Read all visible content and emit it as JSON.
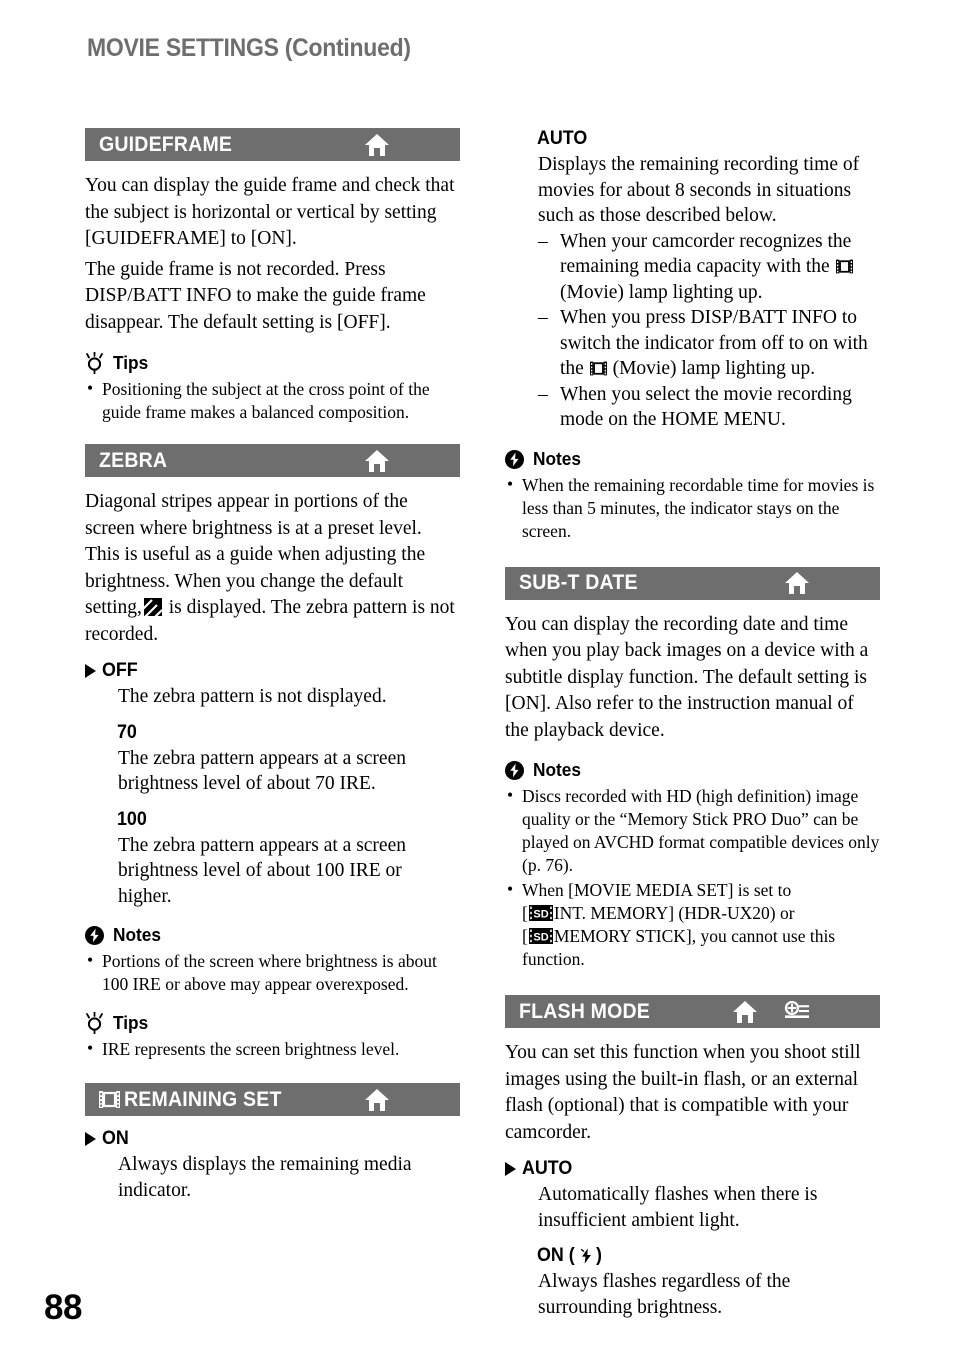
{
  "page": {
    "running_head": "MOVIE SETTINGS (Continued)",
    "page_number": "88",
    "bar_color": "#6e6e6e",
    "head_color": "#6e6e6e"
  },
  "labels": {
    "notes": "Notes",
    "tips": "Tips"
  },
  "left_column": {
    "guideframe": {
      "title": "GUIDEFRAME",
      "body": "You can display the guide frame and check that the subject is horizontal or vertical by setting [GUIDEFRAME] to [ON].",
      "body2": "The guide frame is not recorded. Press DISP/BATT INFO to make the guide frame disappear. The default setting is [OFF].",
      "tips": [
        "Positioning the subject at the cross point of the guide frame makes a balanced composition."
      ]
    },
    "zebra": {
      "title": "ZEBRA",
      "body_part1": "Diagonal stripes appear in portions of the screen where brightness is at a preset level. This is useful as a guide when adjusting the brightness. When you change the default setting,",
      "body_part2": "is displayed. The zebra pattern is not recorded.",
      "options": [
        {
          "name": "OFF",
          "default": true,
          "body": "The zebra pattern is not displayed."
        },
        {
          "name": "70",
          "default": false,
          "body": "The zebra pattern appears at a screen brightness level of about 70 IRE."
        },
        {
          "name": "100",
          "default": false,
          "body": "The zebra pattern appears at a screen brightness level of about 100 IRE or higher."
        }
      ],
      "notes": [
        "Portions of the screen where brightness is about 100 IRE or above may appear overexposed."
      ],
      "tips": [
        "IRE represents the screen brightness level."
      ]
    },
    "remaining_set": {
      "title": "REMAINING SET",
      "options": [
        {
          "name": "ON",
          "default": true,
          "body": "Always displays the remaining media indicator."
        }
      ]
    }
  },
  "right_column": {
    "remaining_set_cont": {
      "options": [
        {
          "name": "AUTO",
          "default": false,
          "body": "Displays the remaining recording time of movies for about 8 seconds in situations such as those described below."
        }
      ],
      "dash_items": [
        {
          "part1": "When your camcorder recognizes the remaining media capacity with the",
          "part2": "(Movie) lamp lighting up."
        },
        {
          "part1": "When you press DISP/BATT INFO to switch the indicator from off to on with the",
          "part2": "(Movie) lamp lighting up."
        },
        {
          "part1": "When you select the movie recording mode on the HOME MENU.",
          "part2": ""
        }
      ],
      "notes": [
        "When the remaining recordable time for movies is less than 5 minutes, the indicator stays on the screen."
      ]
    },
    "sub_t_date": {
      "title": "SUB-T DATE",
      "body": "You can display the recording date and time when you play back images on a device with a subtitle display function. The default setting is [ON]. Also refer to the instruction manual of the playback device.",
      "notes_item1": "Discs recorded with HD (high definition) image quality or the “Memory Stick PRO Duo” can be played on AVCHD format compatible devices only (p. 76).",
      "notes_item2_part1": "When [MOVIE MEDIA SET] is set to",
      "notes_item2_part2": "[",
      "notes_item2_part3": "INT. MEMORY] (HDR-UX20) or",
      "notes_item2_part4": "[",
      "notes_item2_part5": "MEMORY STICK], you cannot use this function."
    },
    "flash_mode": {
      "title": "FLASH MODE",
      "body": "You can set this function when you shoot still images using the built-in flash, or an external flash (optional) that is compatible with your camcorder.",
      "options": [
        {
          "name": "AUTO",
          "default": true,
          "body": "Automatically flashes when there is insufficient ambient light."
        },
        {
          "name_prefix": "ON (",
          "name_suffix": ")",
          "default": false,
          "body": "Always flashes regardless of the surrounding brightness."
        }
      ]
    }
  },
  "icons": {
    "home": "home-icon",
    "option": "option-icon",
    "film": "film-strip-icon",
    "zebra": "zebra-pattern-icon",
    "sd": "sd-memory-icon",
    "flash": "flash-bolt-icon",
    "note": "note-icon",
    "tip": "tip-lightbulb-icon"
  }
}
